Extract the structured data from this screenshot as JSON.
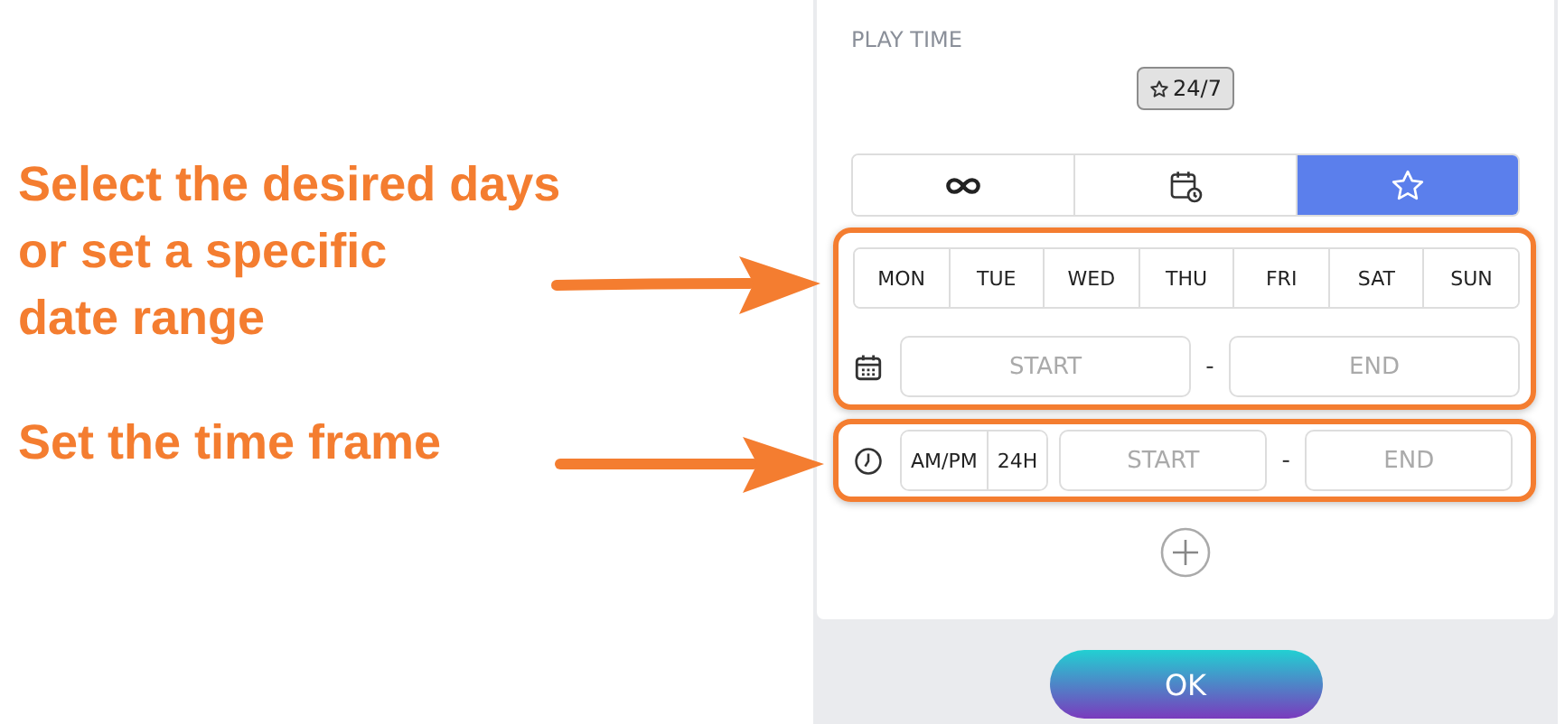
{
  "annotations": [
    {
      "text": "Select the desired days\nor set a specific\ndate range"
    },
    {
      "text": "Set the time frame"
    }
  ],
  "panel": {
    "title": "PLAY TIME",
    "badge": "24/7",
    "modes": [
      {
        "kind": "infinity",
        "selected": false
      },
      {
        "kind": "schedule",
        "selected": false
      },
      {
        "kind": "star",
        "selected": true
      }
    ],
    "days": [
      {
        "label": "MON",
        "selected": false
      },
      {
        "label": "TUE",
        "selected": false
      },
      {
        "label": "WED",
        "selected": false
      },
      {
        "label": "THU",
        "selected": false
      },
      {
        "label": "FRI",
        "selected": false
      },
      {
        "label": "SAT",
        "selected": false
      },
      {
        "label": "SUN",
        "selected": false
      }
    ],
    "date_range": {
      "start": {
        "placeholder": "START"
      },
      "separator": "-",
      "end": {
        "placeholder": "END"
      }
    },
    "time_formats": [
      {
        "label": "AM/PM",
        "selected": false
      },
      {
        "label": "24H",
        "selected": false
      }
    ],
    "time_range": {
      "start": {
        "placeholder": "START"
      },
      "separator": "-",
      "end": {
        "placeholder": "END"
      }
    }
  },
  "ok_button": "OK"
}
